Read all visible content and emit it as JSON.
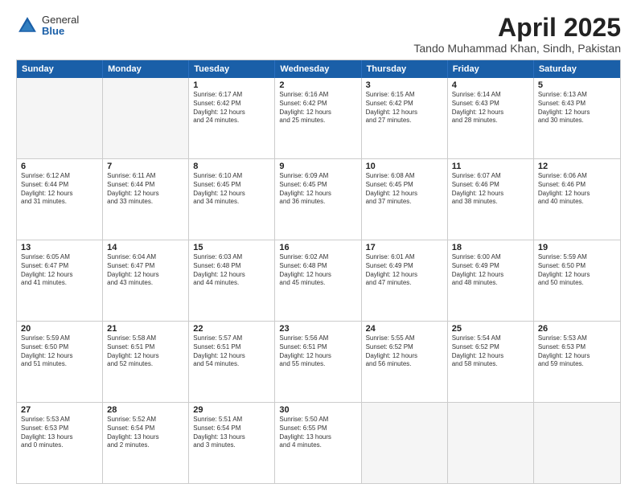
{
  "logo": {
    "general": "General",
    "blue": "Blue"
  },
  "title": {
    "month": "April 2025",
    "location": "Tando Muhammad Khan, Sindh, Pakistan"
  },
  "header_days": [
    "Sunday",
    "Monday",
    "Tuesday",
    "Wednesday",
    "Thursday",
    "Friday",
    "Saturday"
  ],
  "rows": [
    [
      {
        "day": "",
        "empty": true
      },
      {
        "day": "",
        "empty": true
      },
      {
        "day": "1",
        "lines": [
          "Sunrise: 6:17 AM",
          "Sunset: 6:42 PM",
          "Daylight: 12 hours",
          "and 24 minutes."
        ]
      },
      {
        "day": "2",
        "lines": [
          "Sunrise: 6:16 AM",
          "Sunset: 6:42 PM",
          "Daylight: 12 hours",
          "and 25 minutes."
        ]
      },
      {
        "day": "3",
        "lines": [
          "Sunrise: 6:15 AM",
          "Sunset: 6:42 PM",
          "Daylight: 12 hours",
          "and 27 minutes."
        ]
      },
      {
        "day": "4",
        "lines": [
          "Sunrise: 6:14 AM",
          "Sunset: 6:43 PM",
          "Daylight: 12 hours",
          "and 28 minutes."
        ]
      },
      {
        "day": "5",
        "lines": [
          "Sunrise: 6:13 AM",
          "Sunset: 6:43 PM",
          "Daylight: 12 hours",
          "and 30 minutes."
        ]
      }
    ],
    [
      {
        "day": "6",
        "lines": [
          "Sunrise: 6:12 AM",
          "Sunset: 6:44 PM",
          "Daylight: 12 hours",
          "and 31 minutes."
        ]
      },
      {
        "day": "7",
        "lines": [
          "Sunrise: 6:11 AM",
          "Sunset: 6:44 PM",
          "Daylight: 12 hours",
          "and 33 minutes."
        ]
      },
      {
        "day": "8",
        "lines": [
          "Sunrise: 6:10 AM",
          "Sunset: 6:45 PM",
          "Daylight: 12 hours",
          "and 34 minutes."
        ]
      },
      {
        "day": "9",
        "lines": [
          "Sunrise: 6:09 AM",
          "Sunset: 6:45 PM",
          "Daylight: 12 hours",
          "and 36 minutes."
        ]
      },
      {
        "day": "10",
        "lines": [
          "Sunrise: 6:08 AM",
          "Sunset: 6:45 PM",
          "Daylight: 12 hours",
          "and 37 minutes."
        ]
      },
      {
        "day": "11",
        "lines": [
          "Sunrise: 6:07 AM",
          "Sunset: 6:46 PM",
          "Daylight: 12 hours",
          "and 38 minutes."
        ]
      },
      {
        "day": "12",
        "lines": [
          "Sunrise: 6:06 AM",
          "Sunset: 6:46 PM",
          "Daylight: 12 hours",
          "and 40 minutes."
        ]
      }
    ],
    [
      {
        "day": "13",
        "lines": [
          "Sunrise: 6:05 AM",
          "Sunset: 6:47 PM",
          "Daylight: 12 hours",
          "and 41 minutes."
        ]
      },
      {
        "day": "14",
        "lines": [
          "Sunrise: 6:04 AM",
          "Sunset: 6:47 PM",
          "Daylight: 12 hours",
          "and 43 minutes."
        ]
      },
      {
        "day": "15",
        "lines": [
          "Sunrise: 6:03 AM",
          "Sunset: 6:48 PM",
          "Daylight: 12 hours",
          "and 44 minutes."
        ]
      },
      {
        "day": "16",
        "lines": [
          "Sunrise: 6:02 AM",
          "Sunset: 6:48 PM",
          "Daylight: 12 hours",
          "and 45 minutes."
        ]
      },
      {
        "day": "17",
        "lines": [
          "Sunrise: 6:01 AM",
          "Sunset: 6:49 PM",
          "Daylight: 12 hours",
          "and 47 minutes."
        ]
      },
      {
        "day": "18",
        "lines": [
          "Sunrise: 6:00 AM",
          "Sunset: 6:49 PM",
          "Daylight: 12 hours",
          "and 48 minutes."
        ]
      },
      {
        "day": "19",
        "lines": [
          "Sunrise: 5:59 AM",
          "Sunset: 6:50 PM",
          "Daylight: 12 hours",
          "and 50 minutes."
        ]
      }
    ],
    [
      {
        "day": "20",
        "lines": [
          "Sunrise: 5:59 AM",
          "Sunset: 6:50 PM",
          "Daylight: 12 hours",
          "and 51 minutes."
        ]
      },
      {
        "day": "21",
        "lines": [
          "Sunrise: 5:58 AM",
          "Sunset: 6:51 PM",
          "Daylight: 12 hours",
          "and 52 minutes."
        ]
      },
      {
        "day": "22",
        "lines": [
          "Sunrise: 5:57 AM",
          "Sunset: 6:51 PM",
          "Daylight: 12 hours",
          "and 54 minutes."
        ]
      },
      {
        "day": "23",
        "lines": [
          "Sunrise: 5:56 AM",
          "Sunset: 6:51 PM",
          "Daylight: 12 hours",
          "and 55 minutes."
        ]
      },
      {
        "day": "24",
        "lines": [
          "Sunrise: 5:55 AM",
          "Sunset: 6:52 PM",
          "Daylight: 12 hours",
          "and 56 minutes."
        ]
      },
      {
        "day": "25",
        "lines": [
          "Sunrise: 5:54 AM",
          "Sunset: 6:52 PM",
          "Daylight: 12 hours",
          "and 58 minutes."
        ]
      },
      {
        "day": "26",
        "lines": [
          "Sunrise: 5:53 AM",
          "Sunset: 6:53 PM",
          "Daylight: 12 hours",
          "and 59 minutes."
        ]
      }
    ],
    [
      {
        "day": "27",
        "lines": [
          "Sunrise: 5:53 AM",
          "Sunset: 6:53 PM",
          "Daylight: 13 hours",
          "and 0 minutes."
        ]
      },
      {
        "day": "28",
        "lines": [
          "Sunrise: 5:52 AM",
          "Sunset: 6:54 PM",
          "Daylight: 13 hours",
          "and 2 minutes."
        ]
      },
      {
        "day": "29",
        "lines": [
          "Sunrise: 5:51 AM",
          "Sunset: 6:54 PM",
          "Daylight: 13 hours",
          "and 3 minutes."
        ]
      },
      {
        "day": "30",
        "lines": [
          "Sunrise: 5:50 AM",
          "Sunset: 6:55 PM",
          "Daylight: 13 hours",
          "and 4 minutes."
        ]
      },
      {
        "day": "",
        "empty": true
      },
      {
        "day": "",
        "empty": true
      },
      {
        "day": "",
        "empty": true
      }
    ]
  ]
}
